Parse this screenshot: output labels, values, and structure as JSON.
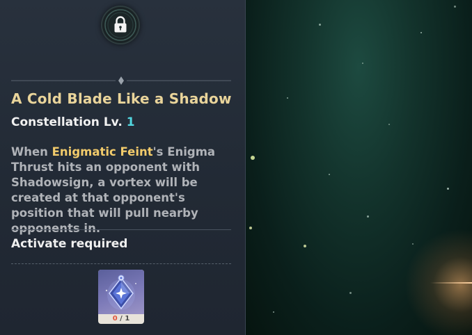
{
  "talent": {
    "title": "A Cold Blade Like a Shadow",
    "level_label": "Constellation Lv.",
    "level_value": "1",
    "desc_prefix": "When ",
    "desc_highlight": "Enigmatic Feint",
    "desc_suffix": "'s Enigma Thrust hits an opponent with Shadowsign, a vortex will be created at that opponent's position that will pull nearby opponents in.",
    "requirement_label": "Activate required"
  },
  "material": {
    "icon": "constellation-item-icon",
    "count_have": "0",
    "count_sep": " / ",
    "count_need": "1"
  },
  "colors": {
    "title_gold": "#e9d49a",
    "level_cyan": "#52d7e0",
    "highlight_gold": "#f2cb6b",
    "panel_bg": "#28313d",
    "count_red": "#e0533b"
  }
}
